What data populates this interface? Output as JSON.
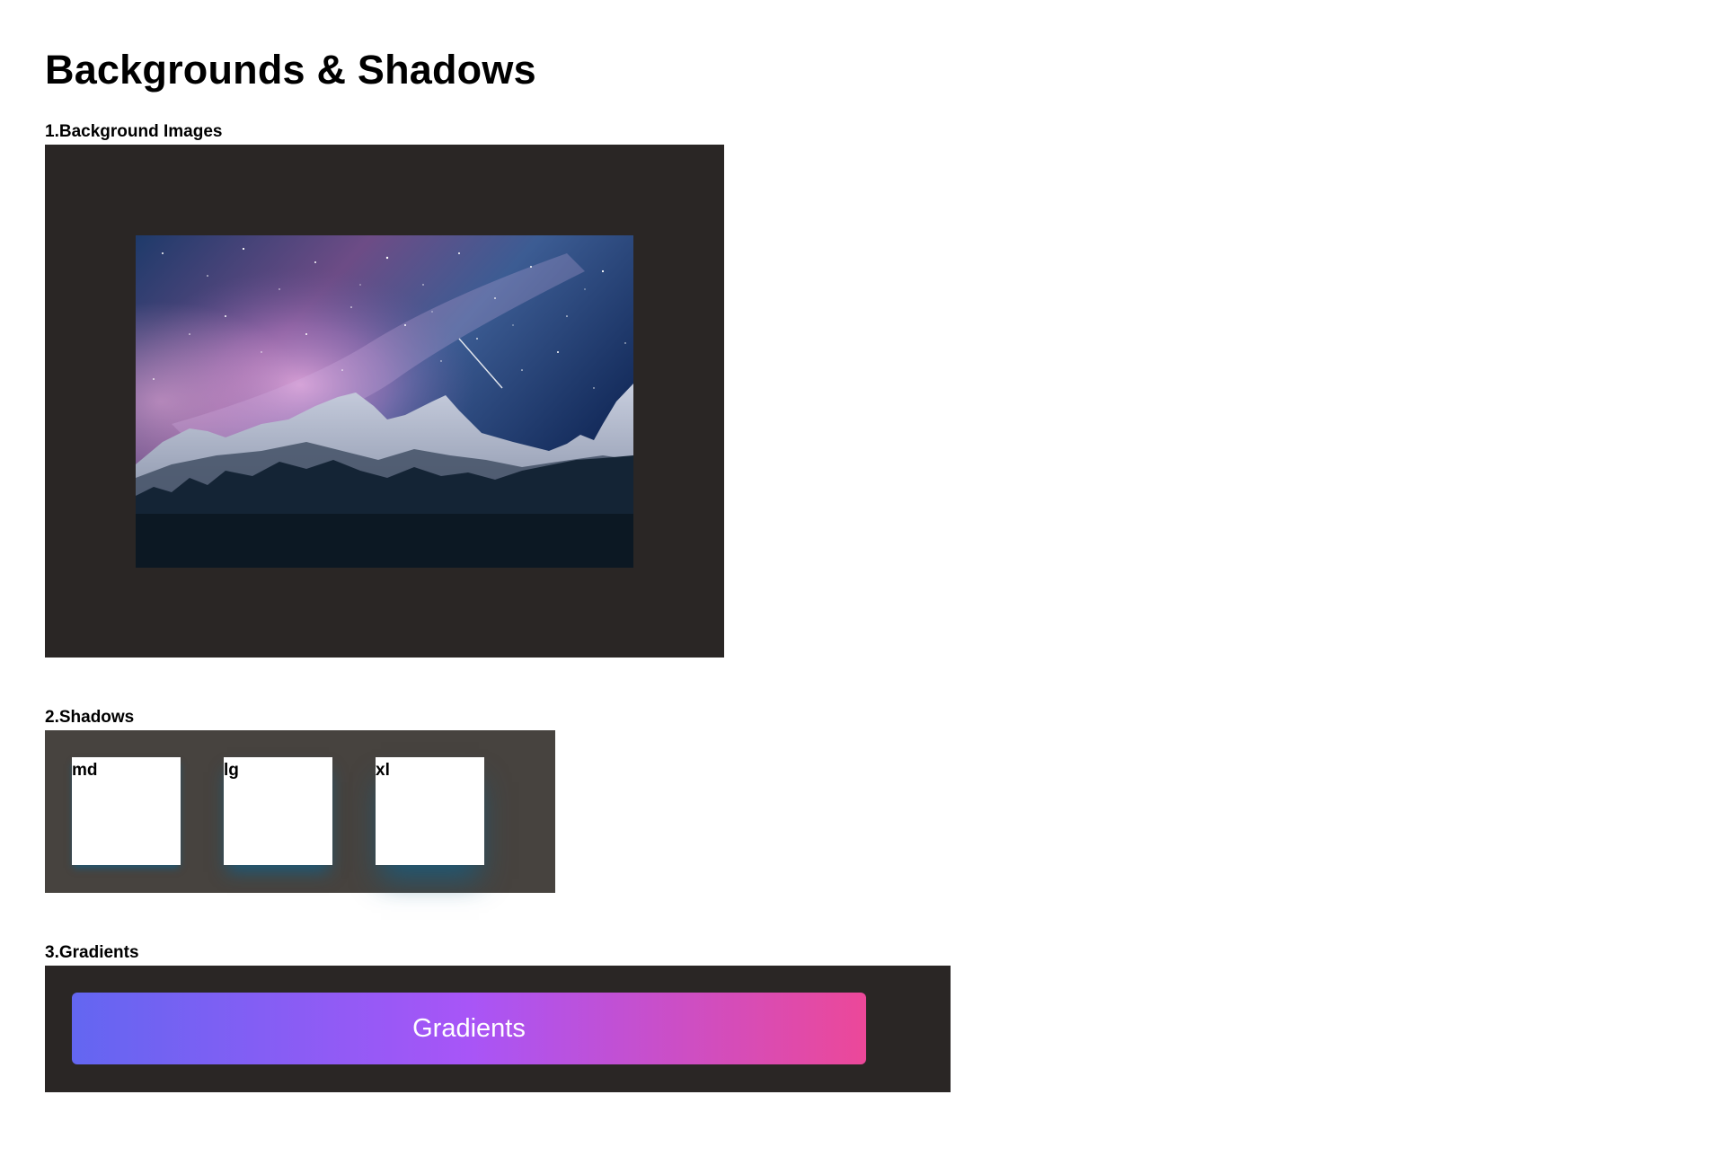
{
  "page": {
    "title": "Backgrounds & Shadows"
  },
  "sections": {
    "background_images": {
      "label": "1.Background Images",
      "image_description_icon": "mountain-night-sky-image"
    },
    "shadows": {
      "label": "2.Shadows",
      "boxes": [
        {
          "label": "md"
        },
        {
          "label": "lg"
        },
        {
          "label": "xl"
        }
      ]
    },
    "gradients": {
      "label": "3.Gradients",
      "button_label": "Gradients"
    }
  },
  "colors": {
    "panel_dark": "#2a2625",
    "panel_shadow": "#47433f",
    "shadow_color": "#155e82",
    "gradient_from": "#6366f1",
    "gradient_via": "#a855f7",
    "gradient_to": "#ec4899"
  }
}
